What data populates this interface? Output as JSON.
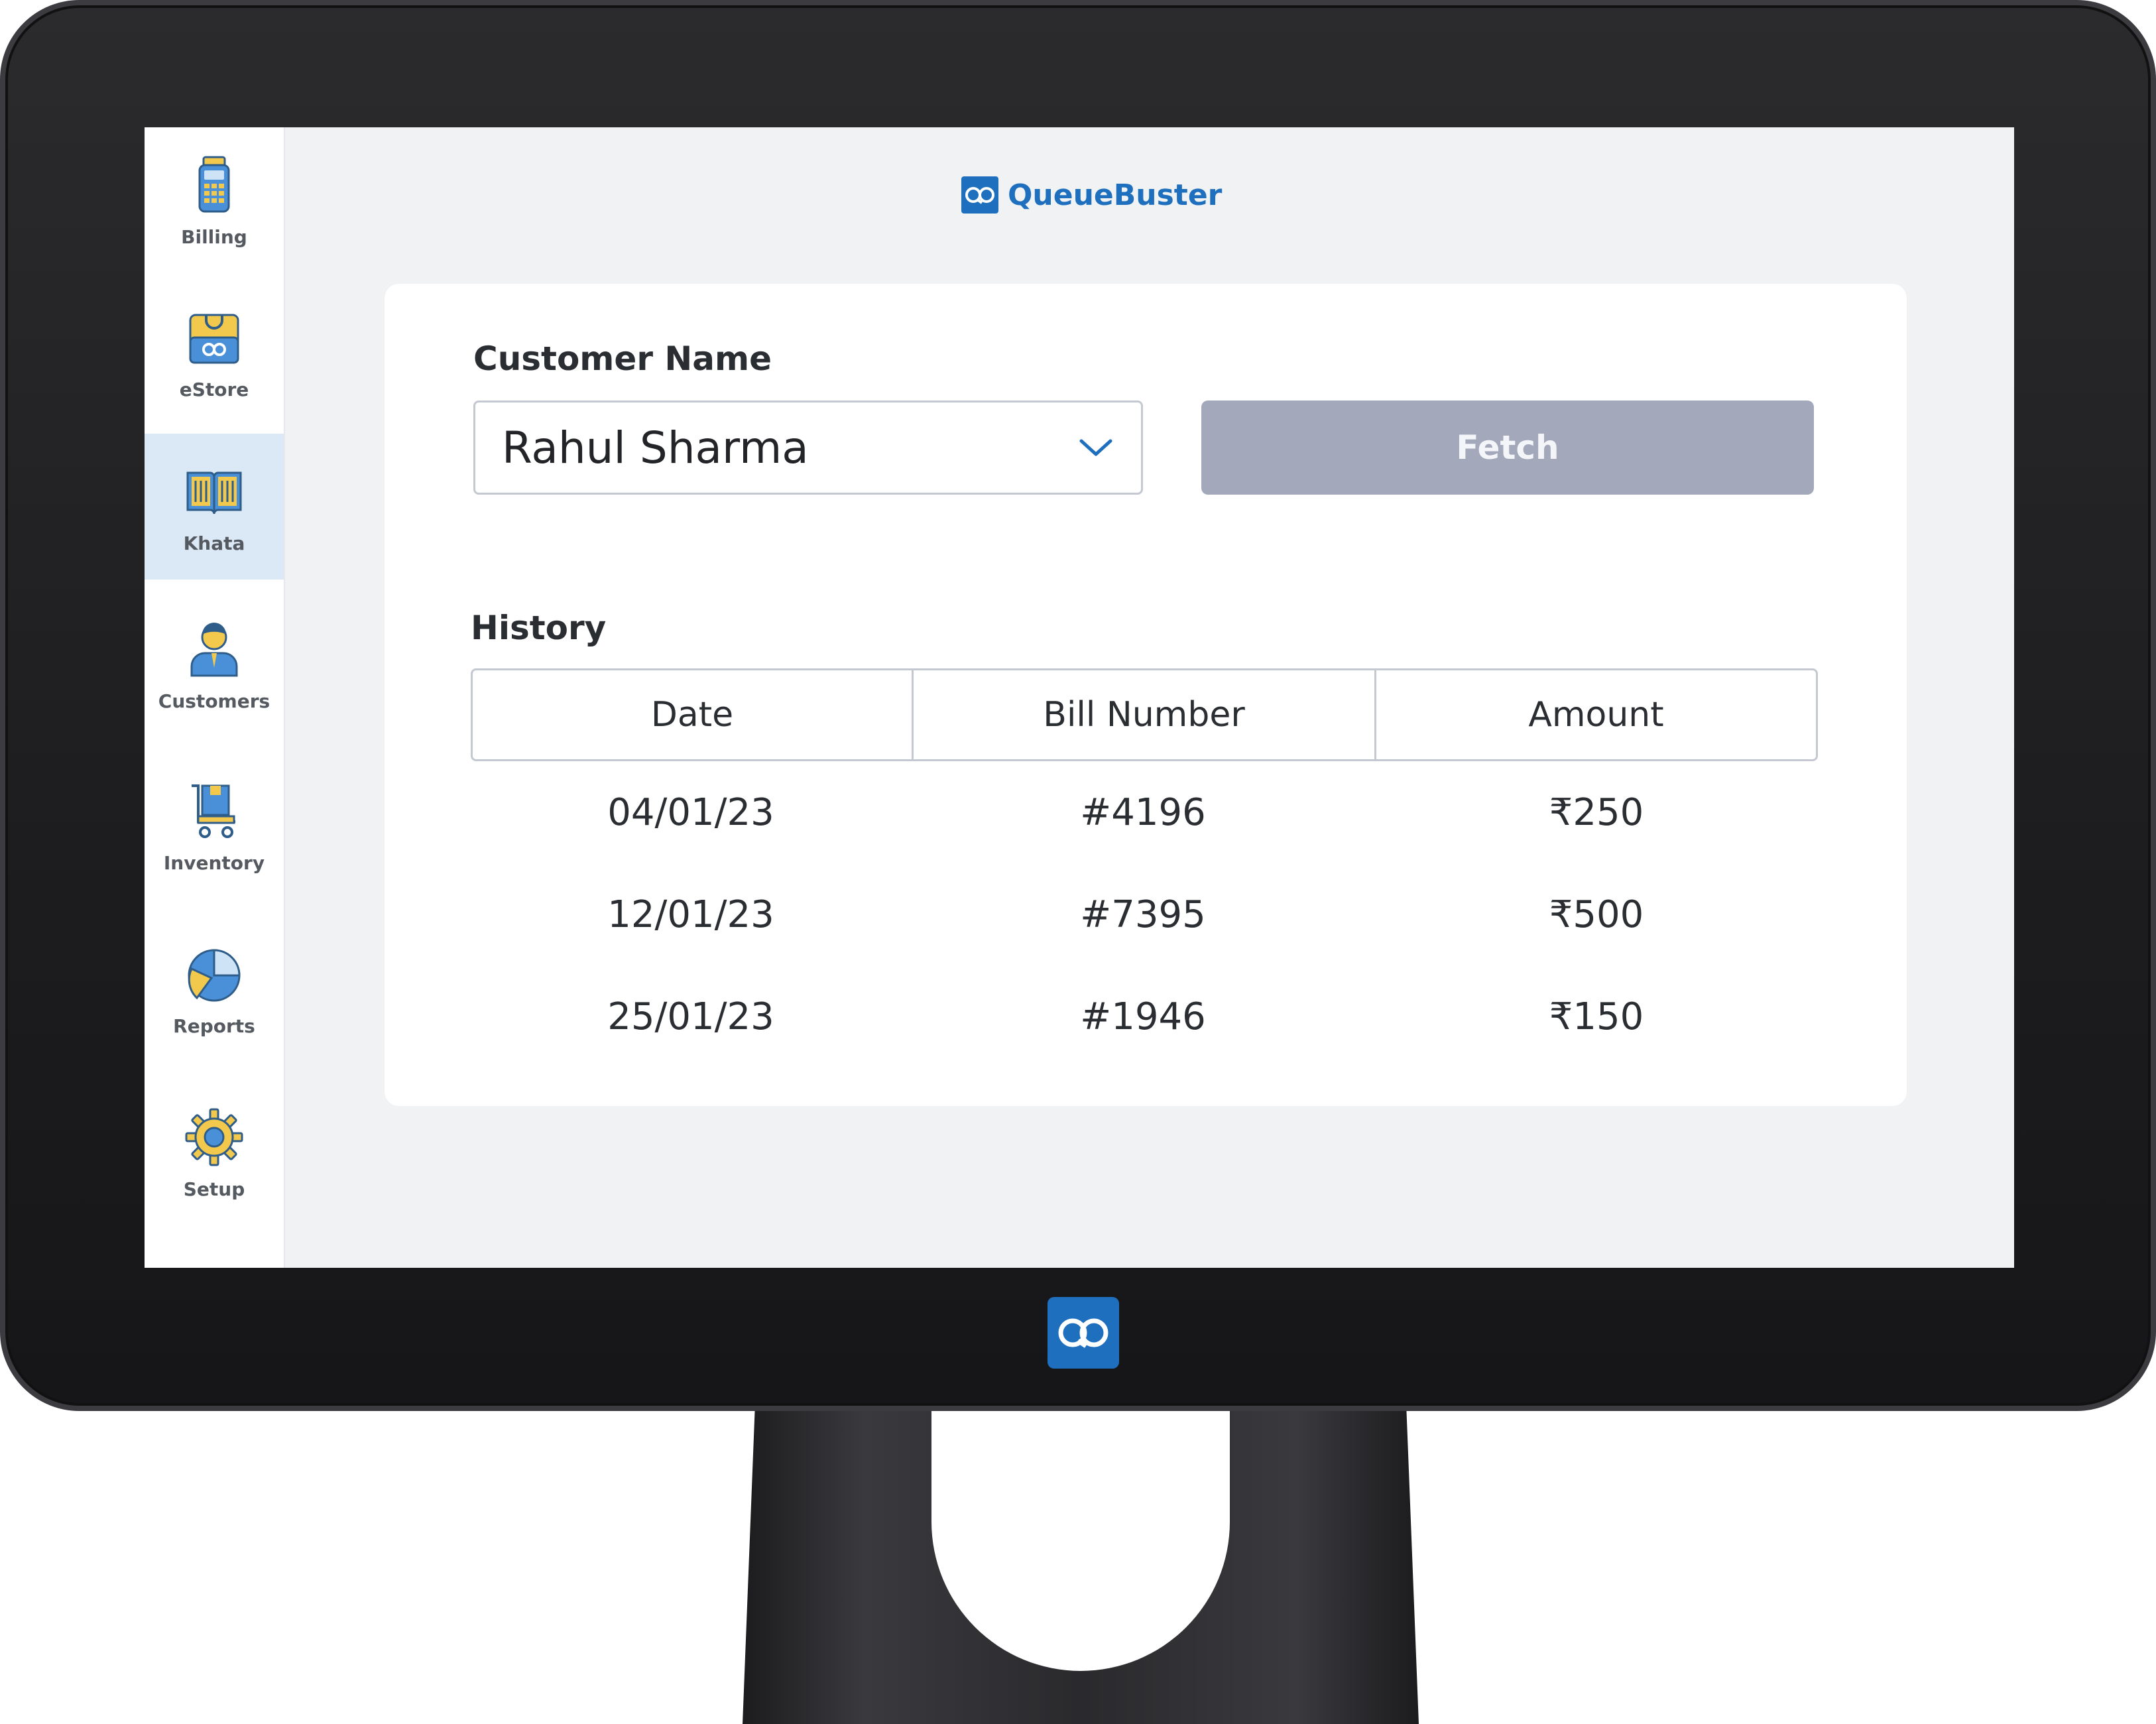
{
  "brand": {
    "name": "QueueBuster",
    "logo_text": "QB",
    "color": "#1f6fbf"
  },
  "sidebar": {
    "items": [
      {
        "label": "Billing",
        "icon": "billing-machine-icon",
        "active": false
      },
      {
        "label": "eStore",
        "icon": "estore-bag-icon",
        "active": false
      },
      {
        "label": "Khata",
        "icon": "open-book-icon",
        "active": true
      },
      {
        "label": "Customers",
        "icon": "customer-person-icon",
        "active": false
      },
      {
        "label": "Inventory",
        "icon": "inventory-cart-icon",
        "active": false
      },
      {
        "label": "Reports",
        "icon": "pie-chart-icon",
        "active": false
      },
      {
        "label": "Setup",
        "icon": "gear-icon",
        "active": false
      }
    ]
  },
  "form": {
    "customer_label": "Customer Name",
    "customer_value": "Rahul Sharma",
    "fetch_label": "Fetch"
  },
  "history": {
    "title": "History",
    "columns": [
      "Date",
      "Bill Number",
      "Amount"
    ],
    "rows": [
      {
        "date": "04/01/23",
        "bill": "#4196",
        "amount": "₹250"
      },
      {
        "date": "12/01/23",
        "bill": "#7395",
        "amount": "₹500"
      },
      {
        "date": "25/01/23",
        "bill": "#1946",
        "amount": "₹150"
      }
    ]
  },
  "colors": {
    "accent": "#1f6fbf",
    "sidebar_active": "#dbe9f7",
    "fetch_disabled": "#a3a9ba",
    "icon_yellow": "#f2c94c",
    "screen_bg": "#f0f2f4"
  }
}
